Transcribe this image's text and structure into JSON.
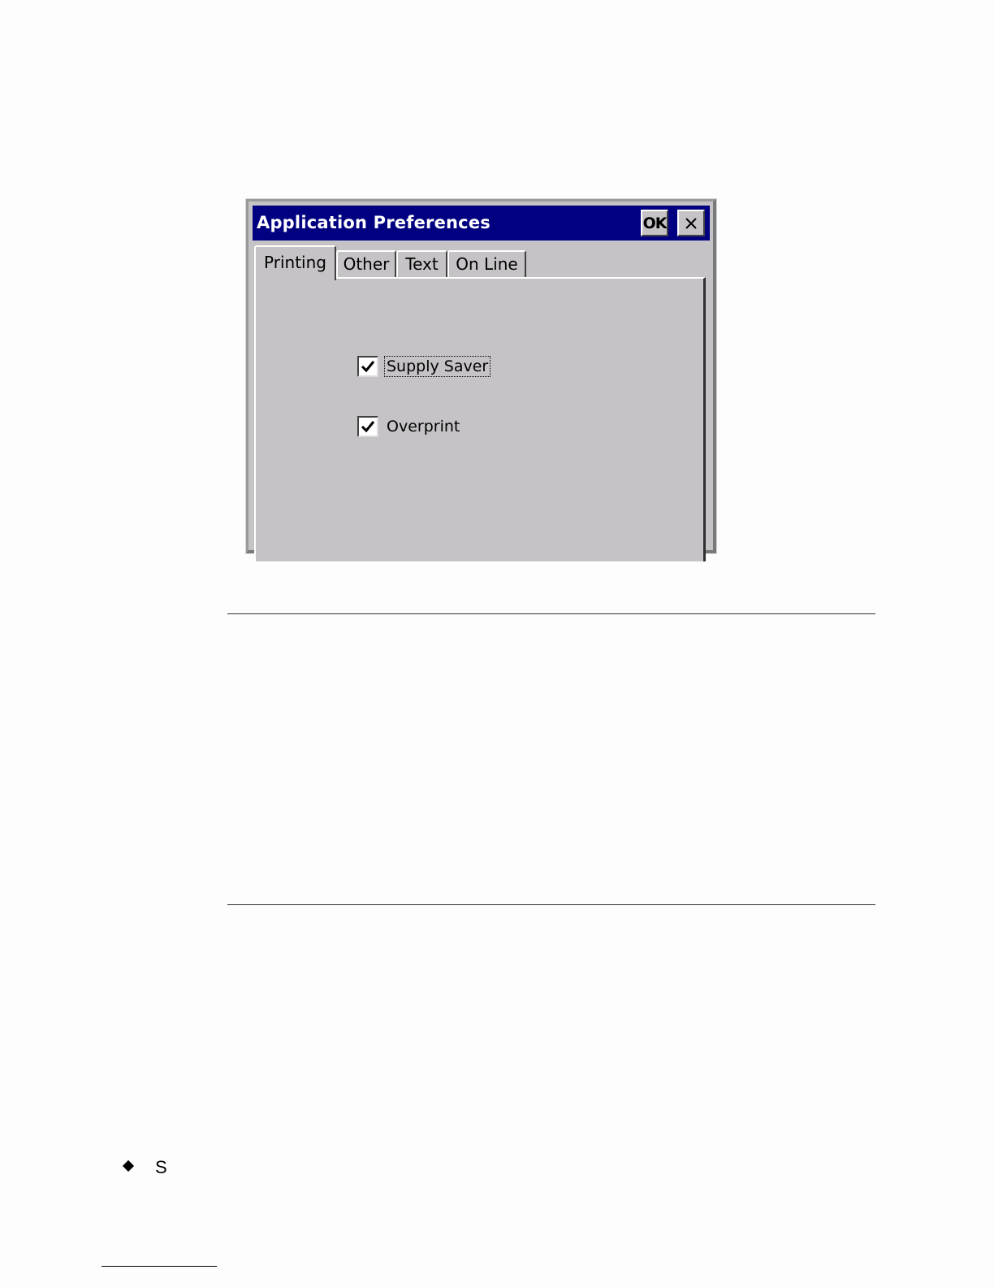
{
  "dialog": {
    "title": "Application Preferences",
    "ok_label": "OK",
    "close_icon": "close-icon",
    "colors": {
      "titlebar": "#000080",
      "face": "#c6c3c6"
    }
  },
  "tabs": [
    {
      "label": "Printing",
      "active": true
    },
    {
      "label": "Other",
      "active": false
    },
    {
      "label": "Text",
      "active": false
    },
    {
      "label": "On Line",
      "active": false
    }
  ],
  "printing": {
    "options": [
      {
        "label": "Supply Saver",
        "checked": true,
        "focused": true
      },
      {
        "label": "Overprint",
        "checked": true,
        "focused": false
      }
    ]
  },
  "page": {
    "bullet_text": "S"
  }
}
